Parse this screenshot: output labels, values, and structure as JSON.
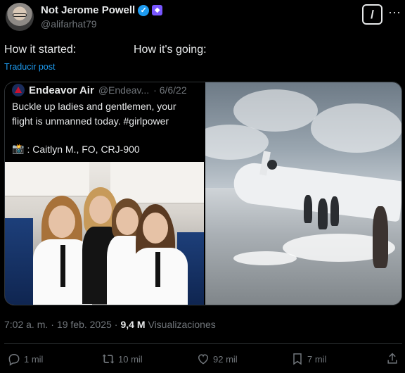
{
  "author": {
    "display_name": "Not Jerome Powell",
    "handle": "@alifarhat79"
  },
  "post": {
    "text_left": "How it started:",
    "text_right": "How it's going:",
    "translate_label": "Traducir post"
  },
  "quoted_tweet": {
    "name": "Endeavor Air",
    "handle": "@Endeav...",
    "date": "· 6/6/22",
    "body": "Buckle up ladies and gentlemen, your flight is unmanned today. #girlpower",
    "crew_line": ": Caitlyn M., FO, CRJ-900"
  },
  "meta": {
    "time": "7:02 a. m.",
    "dot": "·",
    "date": "19 feb. 2025",
    "dot2": "·",
    "views_count": "9,4 M",
    "views_label": "Visualizaciones"
  },
  "actions": {
    "replies": "1 mil",
    "reposts": "10 mil",
    "likes": "92 mil",
    "bookmarks": "7 mil"
  },
  "colors": {
    "background": "#000000",
    "text": "#e7e9ea",
    "muted": "#71767b",
    "link": "#1d9bf0",
    "verified": "#1d9bf0"
  }
}
